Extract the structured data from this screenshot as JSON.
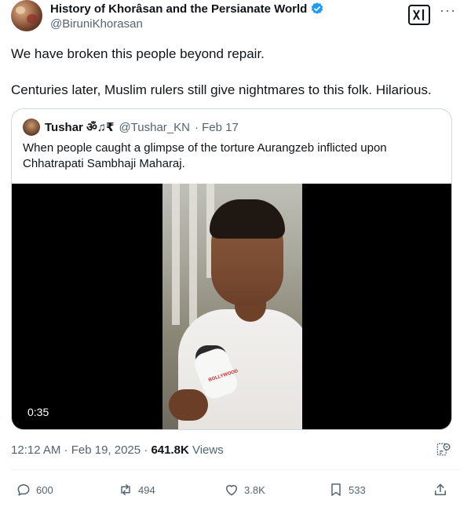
{
  "author": {
    "name": "History of Khorâsan and the Persianate World",
    "handle": "@BiruniKhorasan"
  },
  "tweet": {
    "line1": "We have broken this people beyond repair.",
    "line2": "Centuries later, Muslim rulers still give nightmares to this folk. Hilarious."
  },
  "quote": {
    "name": "Tushar ॐ♫₹",
    "handle": "@Tushar_KN",
    "date": "· Feb 17",
    "text": "When people caught a glimpse of the torture Aurangzeb inflicted upon Chhatrapati Sambhaji Maharaj.",
    "video_duration": "0:35",
    "mic_label": "BOLLYWOOD"
  },
  "meta": {
    "timestamp": "12:12 AM · Feb 19, 2025 · ",
    "views_count": "641.8K",
    "views_label": " Views"
  },
  "actions": {
    "replies": "600",
    "reposts": "494",
    "likes": "3.8K",
    "bookmarks": "533"
  },
  "icons": {
    "verified": "verified-badge-icon",
    "grok": "grok-icon",
    "more": "more-icon",
    "reply": "reply-icon",
    "repost": "repost-icon",
    "like": "like-icon",
    "bookmark": "bookmark-icon",
    "share": "share-icon",
    "analytics": "analytics-icon"
  },
  "colors": {
    "verified": "#1d9bf0",
    "text": "#0f1419",
    "secondary": "#536471",
    "border": "#cfd9de"
  }
}
